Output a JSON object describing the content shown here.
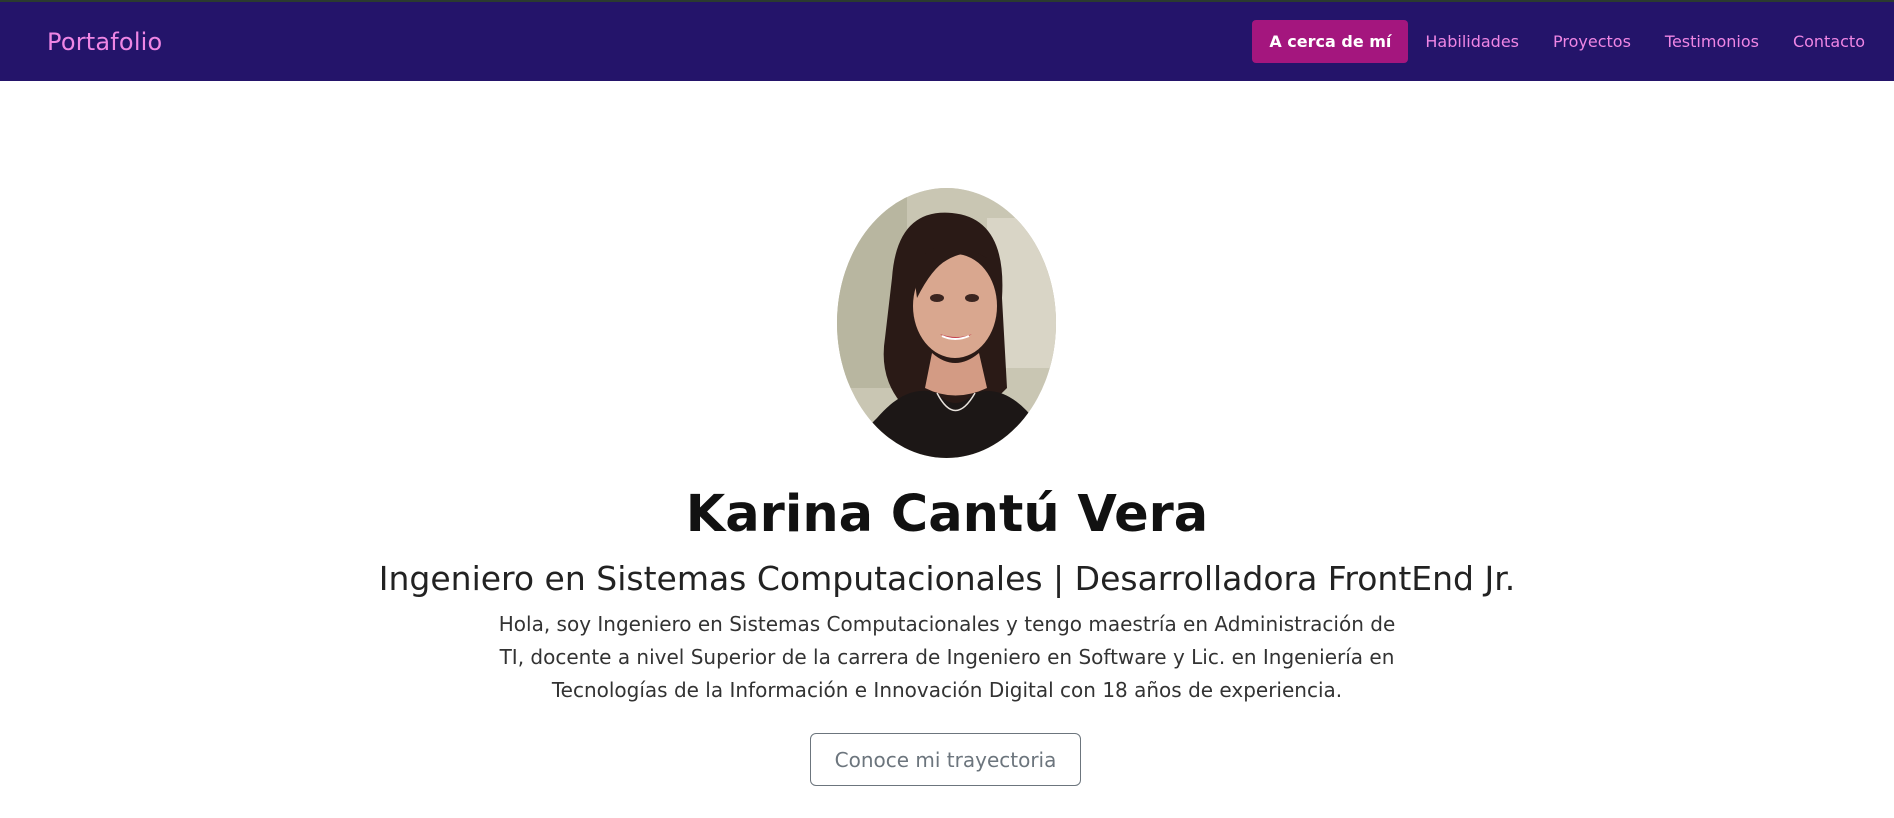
{
  "navbar": {
    "brand": "Portafolio",
    "links": [
      {
        "label": "A cerca de mí",
        "active": true
      },
      {
        "label": "Habilidades",
        "active": false
      },
      {
        "label": "Proyectos",
        "active": false
      },
      {
        "label": "Testimonios",
        "active": false
      },
      {
        "label": "Contacto",
        "active": false
      }
    ]
  },
  "hero": {
    "photo_icon": "profile-photo",
    "name": "Karina Cantú Vera",
    "subtitle": "Ingeniero en Sistemas Computacionales | Desarrolladora FrontEnd Jr.",
    "bio": "Hola, soy Ingeniero en Sistemas Computacionales y tengo maestría en Administración de TI, docente a nivel Superior de la carrera de Ingeniero en Software y Lic. en Ingeniería en Tecnologías de la Información e Innovación Digital con 18 años de experiencia.",
    "cta_label": "Conoce mi trayectoria"
  },
  "colors": {
    "navbar_bg": "#24146a",
    "nav_text": "#ef86e4",
    "active_bg": "#a4167e",
    "button_border": "#6c757d"
  }
}
